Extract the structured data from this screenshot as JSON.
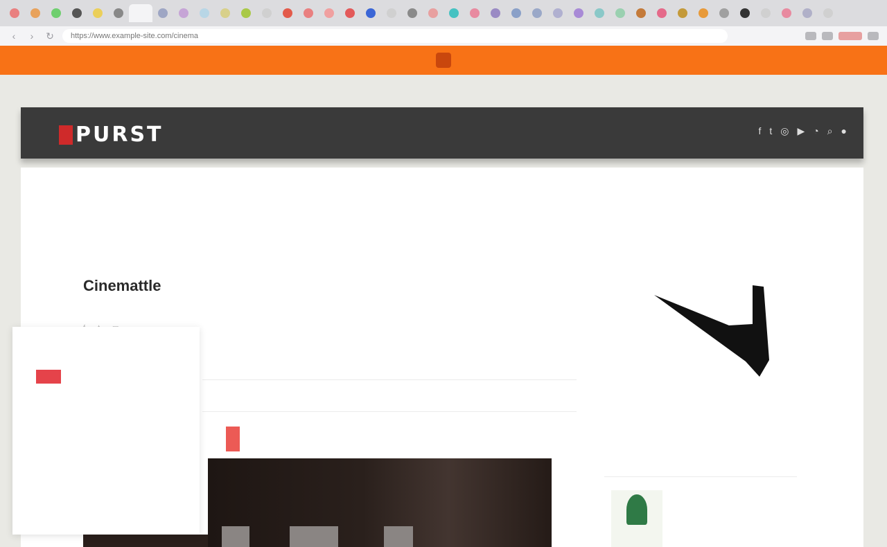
{
  "browser": {
    "url": "https://www.example-site.com/cinema",
    "tab_favicon_colors": [
      "#e98080",
      "#e8a25c",
      "#6fcf6f",
      "#555555",
      "#ebcf5a",
      "#888888",
      "#f4f4f6",
      "#9ea6c4",
      "#c6a4d6",
      "#b8d6e6",
      "#d8d08a",
      "#a9c947",
      "#d0d0d0",
      "#e35a4a",
      "#e98080",
      "#f0a0a0",
      "#e35a5a",
      "#3b66d6",
      "#d0d0d0",
      "#8a8a8a",
      "#e8a0a0",
      "#46c2c2",
      "#e88aa0",
      "#9a8ac4",
      "#8aa0c8",
      "#9aa8c8",
      "#b0b0d0",
      "#a88ad6",
      "#8ac8c8",
      "#9ad0b0",
      "#c47a3a",
      "#e56a8a",
      "#c49a3a",
      "#e89a3a",
      "#a0a0a0",
      "#333333",
      "#d0d0d0",
      "#e88aa0",
      "#b0b0c8",
      "#d0d0d0"
    ]
  },
  "promo": {
    "text_left": "",
    "text_right": ""
  },
  "toplinks": [
    "",
    "",
    "",
    "",
    "",
    "",
    "",
    "",
    ""
  ],
  "header": {
    "logo": "PURST",
    "nav": [
      "",
      "",
      "",
      "",
      "",
      ""
    ],
    "icons": [
      "facebook-icon",
      "twitter-icon",
      "instagram-icon",
      "youtube-icon",
      "rss-icon",
      "search-icon",
      "user-icon"
    ]
  },
  "main": {
    "section_title": "Cinemattle",
    "article_title": "",
    "article_meta": "",
    "category_tag": ""
  },
  "sidebar": {
    "promo_lines": [
      "",
      ""
    ],
    "promo_small": "",
    "trending_label": "",
    "trending_item": {
      "title": "",
      "date": ""
    }
  },
  "cookie": {
    "text": "",
    "link": "",
    "settings_label": "",
    "accept_label": ""
  },
  "colors": {
    "accent_orange": "#f87216",
    "header_dark": "#3a3a3a",
    "brand_red": "#e5434a"
  }
}
